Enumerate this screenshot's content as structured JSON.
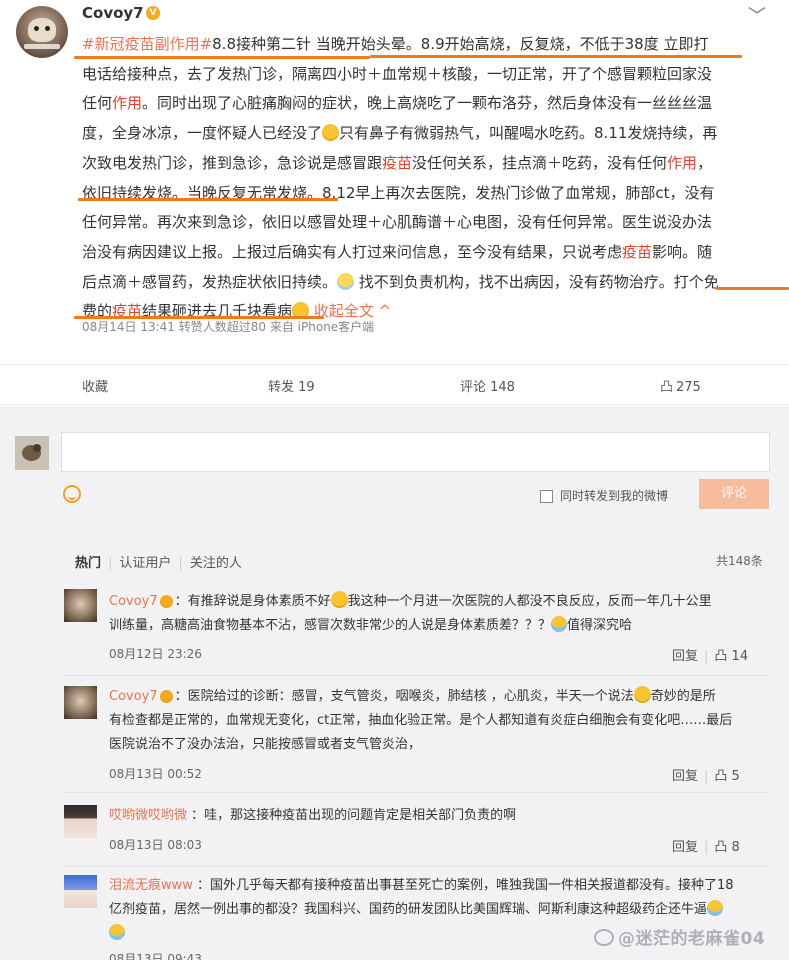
{
  "post": {
    "username": "Covoy7",
    "vip_badge": "V",
    "more": "﹀",
    "lines": [
      [
        {
          "t": "#新冠疫苗副作用#",
          "c": "hash"
        },
        {
          "t": "8.8接种第二针 当晚开始头晕。8.9开始高烧，反复烧，不低于38度 立即打"
        }
      ],
      [
        {
          "t": "电话给接种点，去了发热门诊，隔离四小时＋血常规＋核酸，一切正常，开了个感冒颗粒回家没"
        }
      ],
      [
        {
          "t": "任何"
        },
        {
          "t": "作用",
          "c": "red"
        },
        {
          "t": "。同时出现了心脏痛胸闷的症状，晚上高烧吃了一颗布洛芬，然后身体没有一丝丝丝温"
        }
      ],
      [
        {
          "t": "度，全身冰凉，一度怀疑人已经没了"
        },
        {
          "e": "smile"
        },
        {
          "t": "只有鼻子有微弱热气，叫醒喝水吃药。8.11发烧持续，再"
        }
      ],
      [
        {
          "t": "次致电发热门诊，推到急诊，急诊说是感冒跟"
        },
        {
          "t": "疫苗",
          "c": "red"
        },
        {
          "t": "没任何关系，挂点滴＋吃药，没有任何"
        },
        {
          "t": "作用",
          "c": "red"
        },
        {
          "t": "，"
        }
      ],
      [
        {
          "t": "依旧持续发烧。当晚反复无常发烧。8.12早上再次去医院，发热门诊做了血常规，肺部ct，没有"
        }
      ],
      [
        {
          "t": "任何异常。再次来到急诊，依旧以感冒处理＋心肌酶谱＋心电图，没有任何异常。医生说没办法"
        }
      ],
      [
        {
          "t": "治没有病因建议上报。上报过后确实有人打过来问信息，至今没有结果，只说考虑"
        },
        {
          "t": "疫苗",
          "c": "red"
        },
        {
          "t": "影响。随"
        }
      ],
      [
        {
          "t": "后点滴＋感冒药，发热症状依旧持续。"
        },
        {
          "e": "chick"
        },
        {
          "t": " 找不到负责机构，找不出病因，没有药物治疗。打个免"
        }
      ],
      [
        {
          "t": "费的"
        },
        {
          "t": "疫苗",
          "c": "red"
        },
        {
          "t": "结果砸进去几千块看病"
        },
        {
          "e": "smile"
        },
        {
          "t": " 收起全文 ^",
          "c": "link"
        }
      ]
    ],
    "meta": "08月14日 13:41 转赞人数超过80 来自 iPhone客户端"
  },
  "actions": {
    "collect": "收藏",
    "forward": "转发 19",
    "comment": "评论 148",
    "like_icon": "凸",
    "like": "275"
  },
  "composer": {
    "placeholder": "",
    "also_forward": "同时转发到我的微博",
    "submit": "评论"
  },
  "filters": {
    "hot": "热门",
    "verified": "认证用户",
    "following": "关注的人",
    "total": "共148条"
  },
  "comments": [
    {
      "lines": [
        [
          {
            "t": "Covoy7",
            "c": "name"
          },
          {
            "e": "vip"
          },
          {
            "t": "：有推辞说是身体素质不好"
          },
          {
            "e": "smile"
          },
          {
            "t": "我这种一个月进一次医院的人都没不良反应，反而一年几十公里"
          }
        ],
        [
          {
            "t": "训练量，高糖高油食物基本不沾，感冒次数非常少的人说是身体素质差？？？"
          },
          {
            "e": "cry"
          },
          {
            "t": "值得深究哈"
          }
        ]
      ],
      "date": "08月12日 23:26",
      "reply": "回复",
      "like_icon": "凸",
      "likes": "14"
    },
    {
      "lines": [
        [
          {
            "t": "Covoy7",
            "c": "name"
          },
          {
            "e": "vip"
          },
          {
            "t": "：医院给过的诊断：感冒，支气管炎，咽喉炎，肺结核 ，心肌炎，半天一个说法"
          },
          {
            "e": "smile"
          },
          {
            "t": "奇妙的是所"
          }
        ],
        [
          {
            "t": "有检查都是正常的，血常规无变化，ct正常，抽血化验正常。是个人都知道有炎症白细胞会有变化吧……最后"
          }
        ],
        [
          {
            "t": "医院说治不了没办法治，只能按感冒或者支气管炎治，"
          }
        ]
      ],
      "date": "08月13日 00:52",
      "reply": "回复",
      "like_icon": "凸",
      "likes": "5"
    },
    {
      "lines": [
        [
          {
            "t": "哎哟微哎哟微",
            "c": "name"
          },
          {
            "t": " ：哇，那这接种疫苗出现的问题肯定是相关部门负责的啊"
          }
        ]
      ],
      "date": "08月13日 08:03",
      "reply": "回复",
      "like_icon": "凸",
      "likes": "8"
    },
    {
      "lines": [
        [
          {
            "t": "泪流无痕www",
            "c": "name"
          },
          {
            "t": " ：国外几乎每天都有接种疫苗出事甚至死亡的案例，唯独我国一件相关报道都没有。接种了18"
          }
        ],
        [
          {
            "t": "亿剂疫苗，居然一例出事的都没？我国科兴、国药的研发团队比美国辉瑞、阿斯利康这种超级药企还牛逼"
          },
          {
            "e": "cry"
          }
        ],
        [
          {
            "e": "cry"
          }
        ]
      ],
      "date": "08月13日 09:43",
      "reply": "",
      "like_icon": "",
      "likes": ""
    }
  ],
  "watermark": "@迷茫的老麻雀04"
}
